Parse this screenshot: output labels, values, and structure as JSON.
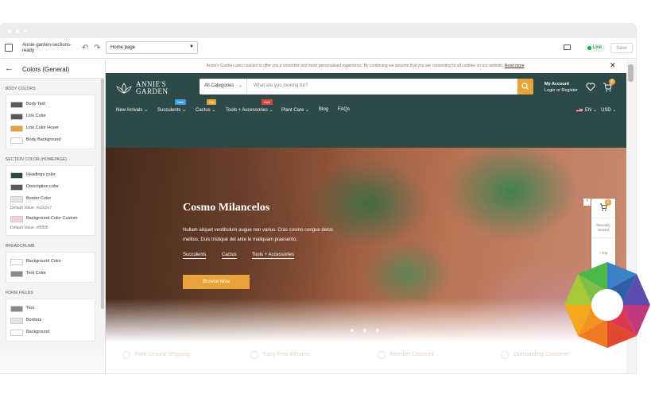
{
  "editor": {
    "theme_name": "Annie-garden-sections-ready",
    "undo_icon": "undo-icon",
    "redo_icon": "redo-icon",
    "page_select": "Home page",
    "status": "Live",
    "save_label": "Save"
  },
  "sidebar": {
    "title": "Colors (General)",
    "sections": [
      {
        "label": "BODY COLORS",
        "items": [
          {
            "label": "Body Text",
            "color": "#5a5a5a"
          },
          {
            "label": "Link Color",
            "color": "#5a5a5a"
          },
          {
            "label": "Link Color Hover",
            "color": "#e8a33d"
          },
          {
            "label": "Body Background",
            "color": "#ffffff"
          }
        ]
      },
      {
        "label": "SECTION COLOR (HOMEPAGE)",
        "items": [
          {
            "label": "Headings color",
            "color": "#2e4a48"
          },
          {
            "label": "Description color",
            "color": "#5a5a5a"
          },
          {
            "label": "Border Color",
            "color": "#e2e2e7",
            "default": "Default Value: #e2e2e7"
          },
          {
            "label": "Background Color Custom",
            "color": "#f5d0d4",
            "default": "Default Value: #f5f5f5"
          }
        ]
      },
      {
        "label": "BREADCRUMB",
        "items": [
          {
            "label": "Background Color",
            "color": "#ffffff"
          },
          {
            "label": "Text Color",
            "color": "#8a8a8a"
          }
        ]
      },
      {
        "label": "FORM FIELDS",
        "items": [
          {
            "label": "Text",
            "color": "#8a8a8a"
          },
          {
            "label": "Borders",
            "color": "#e2e2e7"
          },
          {
            "label": "Background",
            "color": "#ffffff"
          }
        ]
      }
    ]
  },
  "store": {
    "cookie_text": "Annie's Garden uses cookies to offer you a smoother and more personalised experience. By continuing we assume that you are consenting to all cookies on our website.",
    "cookie_link": "Read more",
    "logo_line1": "ANNIE'S",
    "logo_line2": "GARDEN",
    "category_select": "All Categories",
    "search_placeholder": "What are you looking for?",
    "account_line1": "My Account",
    "account_line2": "Login or Register",
    "cart_count": "0",
    "nav": [
      {
        "label": "New Arrivals",
        "caret": true
      },
      {
        "label": "Succulents",
        "caret": true,
        "badge": "New",
        "badge_color": "#3aa0e0"
      },
      {
        "label": "Cactus",
        "caret": true,
        "badge": "Hot",
        "badge_color": "#e8a33d"
      },
      {
        "label": "Tools + Accessories",
        "caret": true,
        "badge": "Sale",
        "badge_color": "#d9433b"
      },
      {
        "label": "Plant Care",
        "caret": true
      },
      {
        "label": "Blog",
        "caret": false
      },
      {
        "label": "FAQs",
        "caret": false
      }
    ],
    "locale": "EN",
    "currency": "USD",
    "hero": {
      "title": "Cosmo Milancelos",
      "text": "Nullam aliquet vestibulum augue non varius. Cras cosmo congue delos melitos. Duis tristique del ante le maliquam praesento.",
      "links": [
        "Succulents",
        "Cactus",
        "Tools + Accessories"
      ],
      "button": "Browse Now",
      "active_slide": 1
    },
    "floater": {
      "count": "0",
      "recent": "Recently viewed",
      "top": "Top"
    },
    "features": [
      "Free Ground Shipping",
      "Easy Free Returns",
      "Member Discount",
      "Outstanding Customer"
    ]
  },
  "colors": {
    "header_bg": "#2e4a48",
    "accent": "#e8a33d"
  }
}
